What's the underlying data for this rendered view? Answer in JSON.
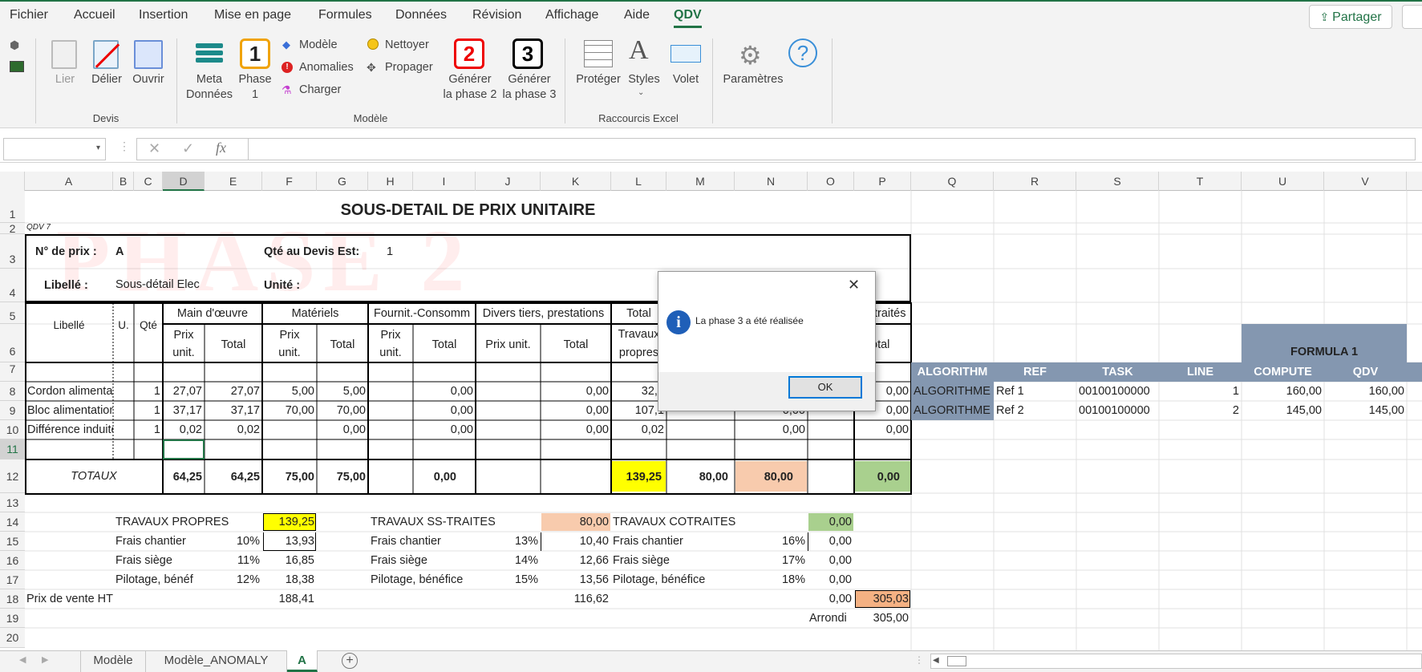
{
  "menu": [
    "Fichier",
    "Accueil",
    "Insertion",
    "Mise en page",
    "Formules",
    "Données",
    "Révision",
    "Affichage",
    "Aide",
    "QDV"
  ],
  "share_label": "Partager",
  "ribbon": {
    "devis": {
      "lier": "Lier",
      "delier": "Délier",
      "ouvrir": "Ouvrir",
      "group": "Devis"
    },
    "modele": {
      "meta1": "Meta",
      "meta2": "Données",
      "phase1a": "Phase",
      "phase1b": "1",
      "phase1num": "1",
      "modele": "Modèle",
      "anomalies": "Anomalies",
      "charger": "Charger",
      "nettoyer": "Nettoyer",
      "propager": "Propager",
      "gen2num": "2",
      "gen2a": "Générer",
      "gen2b": "la phase 2",
      "gen3num": "3",
      "gen3a": "Générer",
      "gen3b": "la phase 3",
      "group": "Modèle"
    },
    "raccourcis": {
      "proteger": "Protéger",
      "styles": "Styles",
      "volet": "Volet",
      "group": "Raccourcis Excel"
    },
    "parametres": "Paramètres"
  },
  "columns": [
    "A",
    "B",
    "C",
    "D",
    "E",
    "F",
    "G",
    "H",
    "I",
    "J",
    "K",
    "L",
    "M",
    "N",
    "O",
    "P",
    "Q",
    "R",
    "S",
    "T",
    "U",
    "V"
  ],
  "rows": [
    "1",
    "2",
    "3",
    "4",
    "5",
    "6",
    "7",
    "8",
    "9",
    "10",
    "11",
    "12",
    "13",
    "14",
    "15",
    "16",
    "17",
    "18",
    "19",
    "20"
  ],
  "sheet": {
    "title": "SOUS-DETAIL DE PRIX UNITAIRE",
    "qdv": "QDV 7",
    "watermark": "PHASE 2",
    "nprix_label": "N° de prix :",
    "nprix_val": "A",
    "qte_label": "Qté au Devis Est:",
    "qte_val": "1",
    "libelle_label": "Libellé :",
    "libelle_val": "Sous-détail Elec",
    "unite_label": "Unité :",
    "h_libelle": "Libellé",
    "h_u": "U.",
    "h_qte": "Qté",
    "h_mo": "Main d'œuvre",
    "h_mat": "Matériels",
    "h_fourn": "Fournit.-Consomm",
    "h_divers": "Divers tiers, prestations",
    "h_total": "Total",
    "h_travaux": "Travaux",
    "h_propres": "propres",
    "h_traites": "traités",
    "h_prix": "Prix",
    "h_unit": "unit.",
    "h_prixunit": "Prix unit.",
    "h_tot": "Total",
    "h_otal": "otal",
    "lines": [
      {
        "lib": "Cordon alimentati",
        "qte": "1",
        "d": "27,07",
        "e": "27,07",
        "f": "5,00",
        "g": "5,00",
        "i": "0,00",
        "k": "0,00",
        "l": "32,0",
        "n": "",
        "p": "0,00"
      },
      {
        "lib": "Bloc alimentation",
        "qte": "1",
        "d": "37,17",
        "e": "37,17",
        "f": "70,00",
        "g": "70,00",
        "i": "0,00",
        "k": "0,00",
        "l": "107,1",
        "n": "0,00",
        "p": "0,00"
      },
      {
        "lib": "Différence induite",
        "qte": "1",
        "d": "0,02",
        "e": "0,02",
        "f": "",
        "g": "0,00",
        "i": "0,00",
        "k": "0,00",
        "l": "0,02",
        "n": "0,00",
        "p": "0,00"
      }
    ],
    "totaux": {
      "label": "TOTAUX",
      "d": "64,25",
      "e": "64,25",
      "f": "75,00",
      "g": "75,00",
      "i": "0,00",
      "l": "139,25",
      "m": "80,00",
      "n": "80,00",
      "p": "0,00"
    },
    "summary": {
      "tp_label": "TRAVAUX PROPRES",
      "tp_val": "139,25",
      "fc_label": "Frais chantier",
      "fc_pct": "10%",
      "fc_val": "13,93",
      "fs_label": "Frais siège",
      "fs_pct": "11%",
      "fs_val": "16,85",
      "pb_label": "Pilotage, bénéf",
      "pb_pct": "12%",
      "pb_val": "18,38",
      "st_label": "TRAVAUX SS-TRAITES",
      "st_val": "80,00",
      "st_fc_label": "Frais chantier",
      "st_fc_pct": "13%",
      "st_fc_val": "10,40",
      "st_fs_label": "Frais siège",
      "st_fs_pct": "14%",
      "st_fs_val": "12,66",
      "st_pb_label": "Pilotage, bénéfice",
      "st_pb_pct": "15%",
      "st_pb_val": "13,56",
      "ct_label": "TRAVAUX COTRAITES",
      "ct_val": "0,00",
      "ct_fc_label": "Frais chantier",
      "ct_fc_pct": "16%",
      "ct_fc_val": "0,00",
      "ct_fs_label": "Frais siège",
      "ct_fs_pct": "17%",
      "ct_fs_val": "0,00",
      "ct_pb_label": "Pilotage, bénéfice",
      "ct_pb_pct": "18%",
      "ct_pb_val": "0,00",
      "pv_label": "Prix de vente HT",
      "pv_f": "188,41",
      "pv_k": "116,62",
      "pv_o": "0,00",
      "pv_p": "305,03",
      "arrondi_label": "Arrondi",
      "arrondi_val": "305,00"
    },
    "algo": {
      "formula_title": "FORMULA 1",
      "headers": [
        "ALGORITHM",
        "REF",
        "TASK",
        "LINE",
        "COMPUTE",
        "QDV"
      ],
      "rows": [
        [
          "ALGORITHME",
          "Ref 1",
          "00100100000",
          "1",
          "160,00",
          "160,00"
        ],
        [
          "ALGORITHME",
          "Ref 2",
          "00100100000",
          "2",
          "145,00",
          "145,00"
        ]
      ]
    }
  },
  "tabs": [
    "Modèle",
    "Modèle_ANOMALY",
    "A"
  ],
  "dialog": {
    "message": "La phase 3 a été réalisée",
    "ok": "OK"
  },
  "colors": {
    "excel_green": "#217346",
    "yellow": "#ffff00",
    "peach": "#f8cbad",
    "green": "#a9d08e",
    "orange": "#f4b183",
    "algo_header": "#8497b0"
  }
}
